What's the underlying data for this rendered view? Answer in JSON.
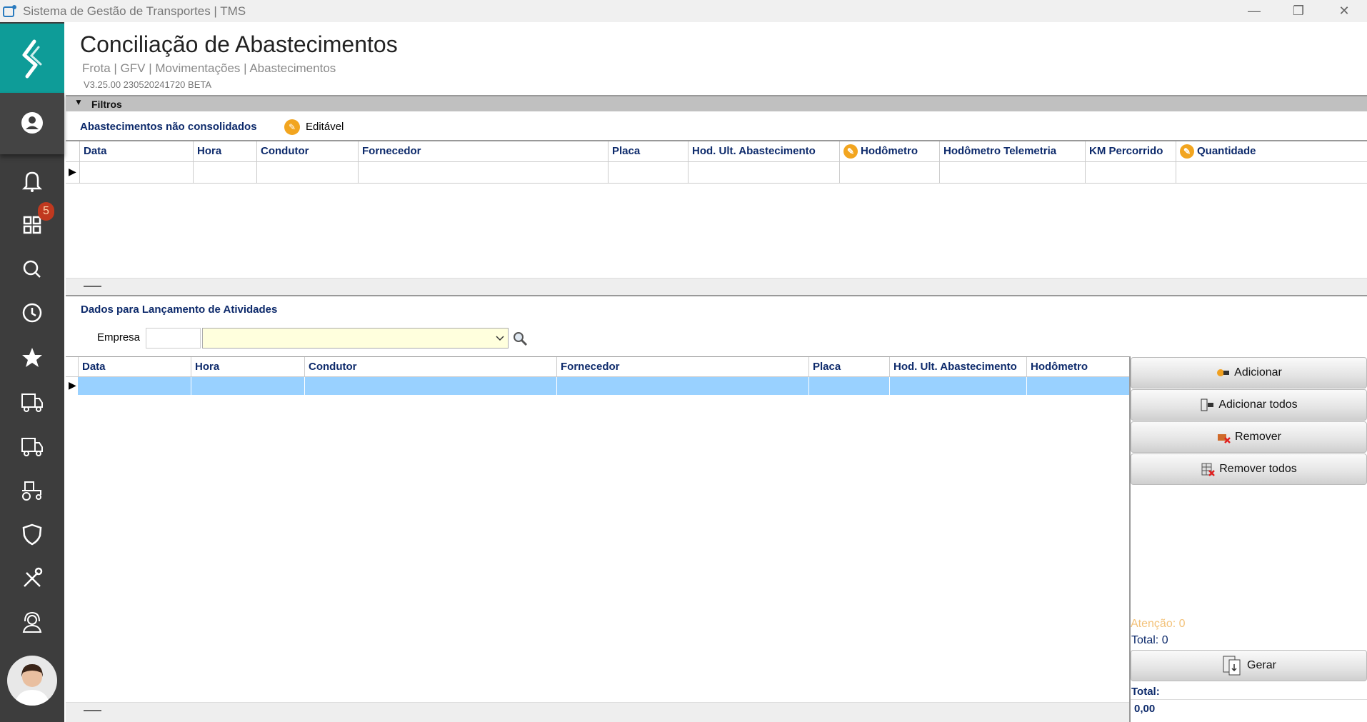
{
  "window": {
    "title": "Sistema de Gestão de Transportes | TMS",
    "minimize": "—",
    "restore": "❐",
    "close": "✕"
  },
  "header": {
    "title": "Conciliação de Abastecimentos",
    "breadcrumb": "Frota | GFV | Movimentações | Abastecimentos",
    "version": "V3.25.00 230520241720 BETA"
  },
  "sidebar": {
    "badge": "5",
    "items": [
      "user",
      "bell",
      "apps",
      "search",
      "history",
      "star",
      "truck",
      "truck-2",
      "tractor",
      "shield",
      "tools",
      "support"
    ]
  },
  "filters": {
    "label": "Filtros"
  },
  "unconsolidated": {
    "title": "Abastecimentos não consolidados",
    "editable_label": "Editável",
    "columns": [
      "Data",
      "Hora",
      "Condutor",
      "Fornecedor",
      "Placa",
      "Hod. Ult. Abastecimento",
      "Hodômetro",
      "Hodômetro Telemetria",
      "KM Percorrido",
      "Quantidade"
    ]
  },
  "launch": {
    "title": "Dados para Lançamento de Atividades",
    "empresa_label": "Empresa",
    "empresa_code": "",
    "empresa_value": "",
    "columns": [
      "Data",
      "Hora",
      "Condutor",
      "Fornecedor",
      "Placa",
      "Hod. Ult. Abastecimento",
      "Hodômetro"
    ]
  },
  "actions": {
    "add": "Adicionar",
    "add_all": "Adicionar todos",
    "remove": "Remover",
    "remove_all": "Remover todos",
    "generate": "Gerar"
  },
  "summary": {
    "attention": "Atenção: 0",
    "total_count": "Total: 0",
    "total_label": "Total:",
    "total_value": "0,00"
  },
  "colors": {
    "teal": "#0e9c98",
    "sidebar": "#3d3d3d",
    "selected_row": "#99d1ff",
    "attention": "#f3c27a",
    "label_blue": "#0d2a6b"
  }
}
